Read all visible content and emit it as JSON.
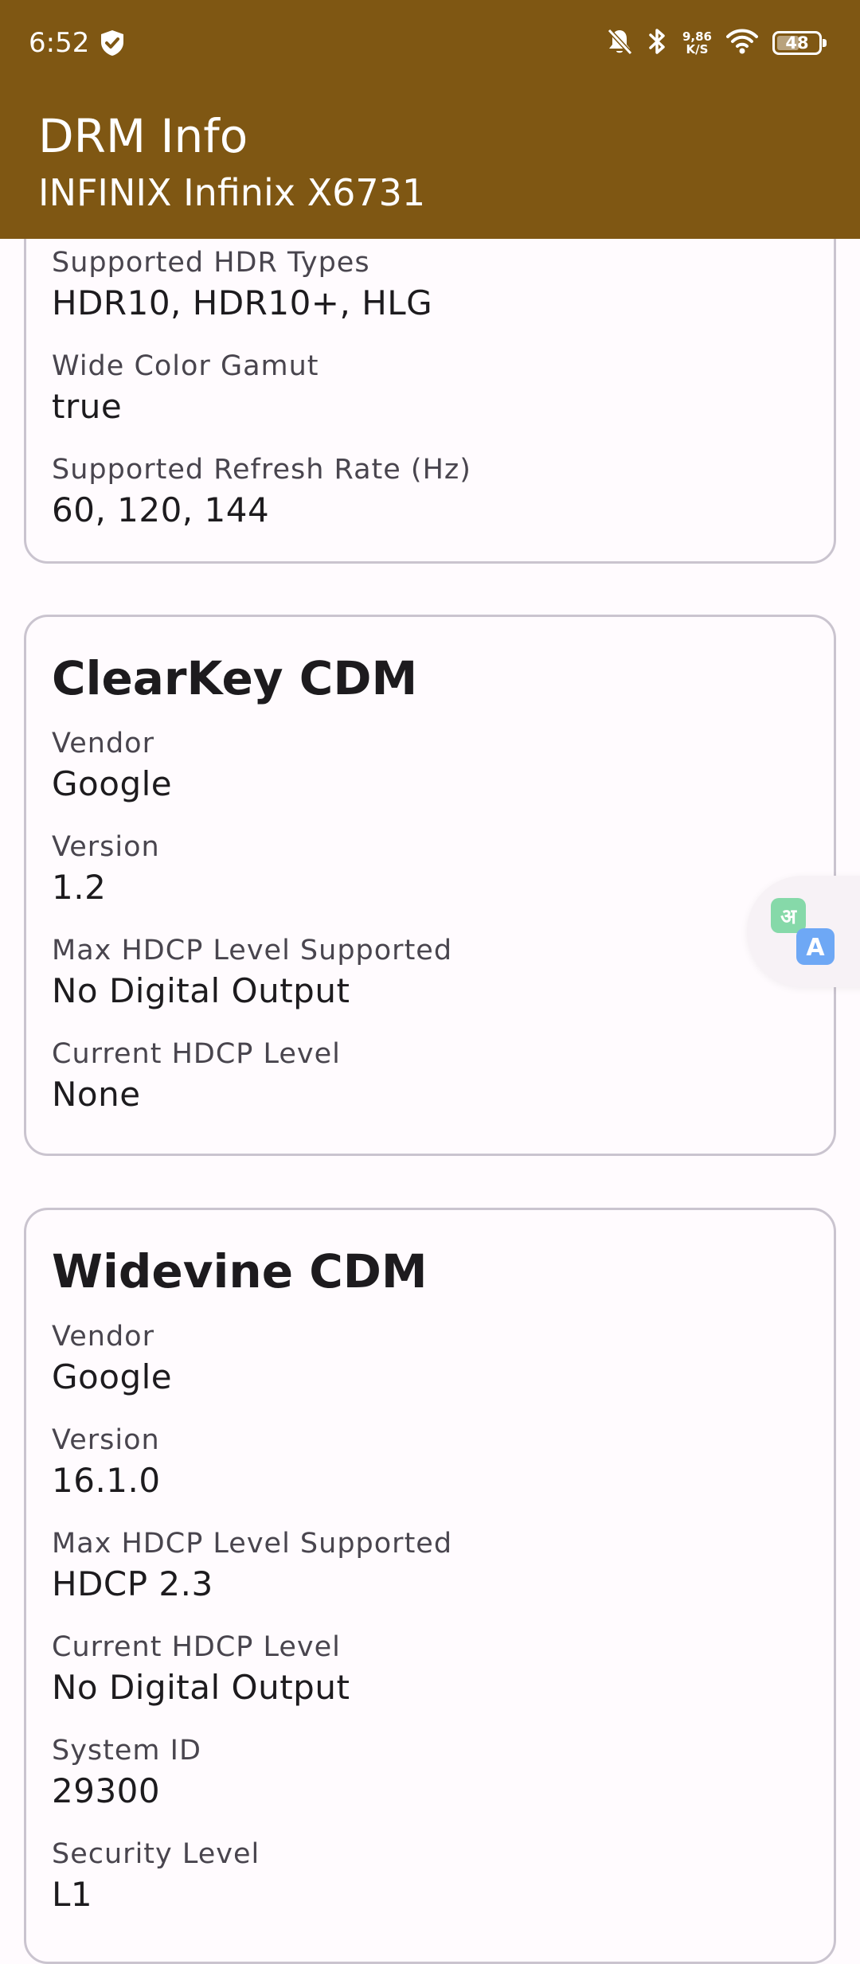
{
  "status_bar": {
    "time": "6:52",
    "net_speed_value": "9,86",
    "net_speed_unit": "K/S",
    "battery": "48",
    "icons": [
      "shield-icon",
      "bell-off-icon",
      "bluetooth-icon",
      "wifi-icon",
      "battery-icon"
    ]
  },
  "app_bar": {
    "title": "DRM Info",
    "subtitle": "INFINIX Infinix X6731",
    "background_color": "#7f5713"
  },
  "display_card": {
    "fields": [
      {
        "label": "Supported HDR Types",
        "value": "HDR10, HDR10+, HLG"
      },
      {
        "label": "Wide Color Gamut",
        "value": "true"
      },
      {
        "label": "Supported Refresh Rate (Hz)",
        "value": "60, 120, 144"
      }
    ]
  },
  "clearkey_card": {
    "title": "ClearKey CDM",
    "fields": [
      {
        "label": "Vendor",
        "value": "Google"
      },
      {
        "label": "Version",
        "value": "1.2"
      },
      {
        "label": "Max HDCP Level Supported",
        "value": "No Digital Output"
      },
      {
        "label": "Current HDCP Level",
        "value": "None"
      }
    ]
  },
  "widevine_card": {
    "title": "Widevine CDM",
    "fields": [
      {
        "label": "Vendor",
        "value": "Google"
      },
      {
        "label": "Version",
        "value": "16.1.0"
      },
      {
        "label": "Max HDCP Level Supported",
        "value": "HDCP 2.3"
      },
      {
        "label": "Current HDCP Level",
        "value": "No Digital Output"
      },
      {
        "label": "System ID",
        "value": "29300"
      },
      {
        "label": "Security Level",
        "value": "L1"
      }
    ]
  },
  "translate_button": {
    "icon": "translate-icon"
  }
}
